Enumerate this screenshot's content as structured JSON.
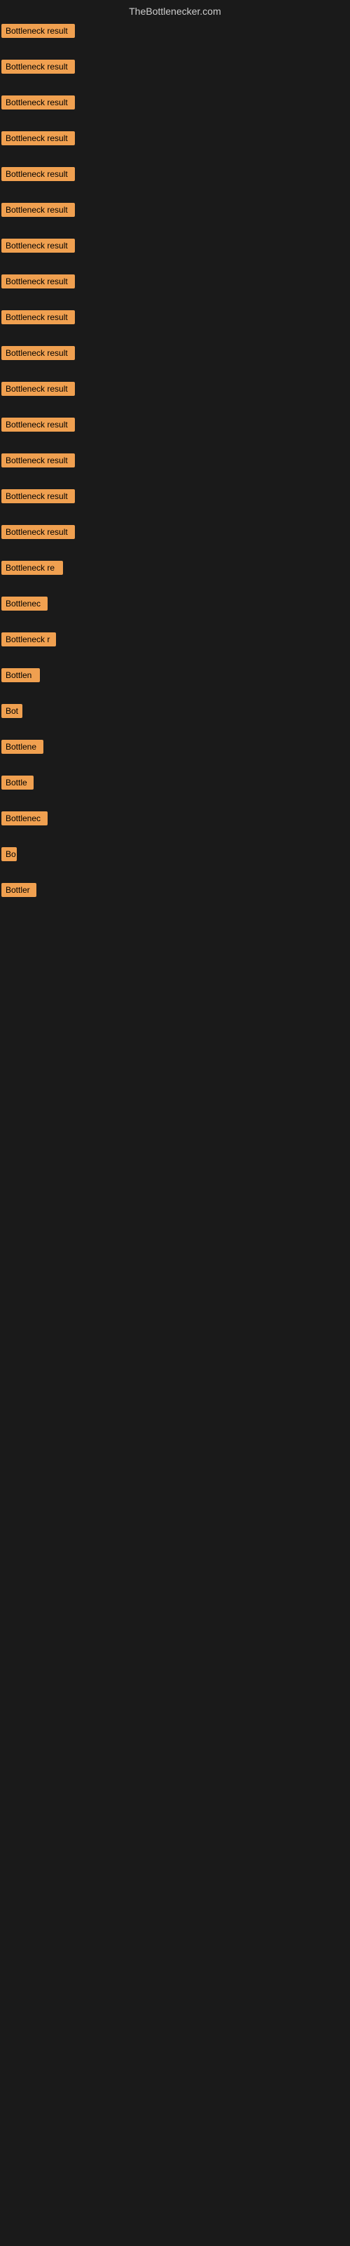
{
  "header": {
    "title": "TheBottlenecker.com"
  },
  "items": [
    {
      "id": 1,
      "label": "Bottleneck result",
      "width": 105,
      "spacer": 18
    },
    {
      "id": 2,
      "label": "Bottleneck result",
      "width": 105,
      "spacer": 18
    },
    {
      "id": 3,
      "label": "Bottleneck result",
      "width": 105,
      "spacer": 18
    },
    {
      "id": 4,
      "label": "Bottleneck result",
      "width": 105,
      "spacer": 18
    },
    {
      "id": 5,
      "label": "Bottleneck result",
      "width": 105,
      "spacer": 18
    },
    {
      "id": 6,
      "label": "Bottleneck result",
      "width": 105,
      "spacer": 18
    },
    {
      "id": 7,
      "label": "Bottleneck result",
      "width": 105,
      "spacer": 18
    },
    {
      "id": 8,
      "label": "Bottleneck result",
      "width": 105,
      "spacer": 18
    },
    {
      "id": 9,
      "label": "Bottleneck result",
      "width": 105,
      "spacer": 18
    },
    {
      "id": 10,
      "label": "Bottleneck result",
      "width": 105,
      "spacer": 18
    },
    {
      "id": 11,
      "label": "Bottleneck result",
      "width": 105,
      "spacer": 18
    },
    {
      "id": 12,
      "label": "Bottleneck result",
      "width": 105,
      "spacer": 18
    },
    {
      "id": 13,
      "label": "Bottleneck result",
      "width": 105,
      "spacer": 18
    },
    {
      "id": 14,
      "label": "Bottleneck result",
      "width": 105,
      "spacer": 18
    },
    {
      "id": 15,
      "label": "Bottleneck result",
      "width": 105,
      "spacer": 18
    },
    {
      "id": 16,
      "label": "Bottleneck re",
      "width": 88,
      "spacer": 18
    },
    {
      "id": 17,
      "label": "Bottlenec",
      "width": 66,
      "spacer": 18
    },
    {
      "id": 18,
      "label": "Bottleneck r",
      "width": 78,
      "spacer": 18
    },
    {
      "id": 19,
      "label": "Bottlen",
      "width": 55,
      "spacer": 18
    },
    {
      "id": 20,
      "label": "Bot",
      "width": 30,
      "spacer": 18
    },
    {
      "id": 21,
      "label": "Bottlene",
      "width": 60,
      "spacer": 18
    },
    {
      "id": 22,
      "label": "Bottle",
      "width": 46,
      "spacer": 18
    },
    {
      "id": 23,
      "label": "Bottlenec",
      "width": 66,
      "spacer": 18
    },
    {
      "id": 24,
      "label": "Bo",
      "width": 22,
      "spacer": 18
    },
    {
      "id": 25,
      "label": "Bottler",
      "width": 50,
      "spacer": 18
    }
  ],
  "colors": {
    "badge_bg": "#f0a050",
    "badge_text": "#000000",
    "header_text": "#cccccc",
    "background": "#1a1a1a"
  }
}
